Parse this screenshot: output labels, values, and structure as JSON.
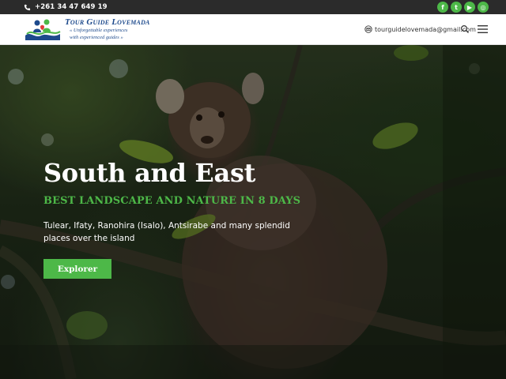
{
  "topbar": {
    "phone": "+261 34 47 649 19",
    "socials": [
      {
        "icon": "facebook-icon",
        "glyph": "f"
      },
      {
        "icon": "twitter-icon",
        "glyph": "t"
      },
      {
        "icon": "youtube-icon",
        "glyph": "▶"
      },
      {
        "icon": "tripadvisor-icon",
        "glyph": "◎"
      }
    ]
  },
  "header": {
    "brand_name": "Tour Guide Lovemada",
    "tagline_1": "« Unforgettable experiences",
    "tagline_2": "with experienced guides »",
    "email": "tourguidelovemada@gmail.com"
  },
  "hero": {
    "title": "South and East",
    "subtitle": "BEST LANDSCAPE AND NATURE IN 8 DAYS",
    "description": "Tulear, Ifaty, Ranohira (Isalo), Antsirabe and many splendid places over the island",
    "button_label": "Explorer"
  },
  "colors": {
    "accent": "#4db848",
    "brand_blue": "#1d4a8c",
    "topbar": "#2b2b2b"
  }
}
